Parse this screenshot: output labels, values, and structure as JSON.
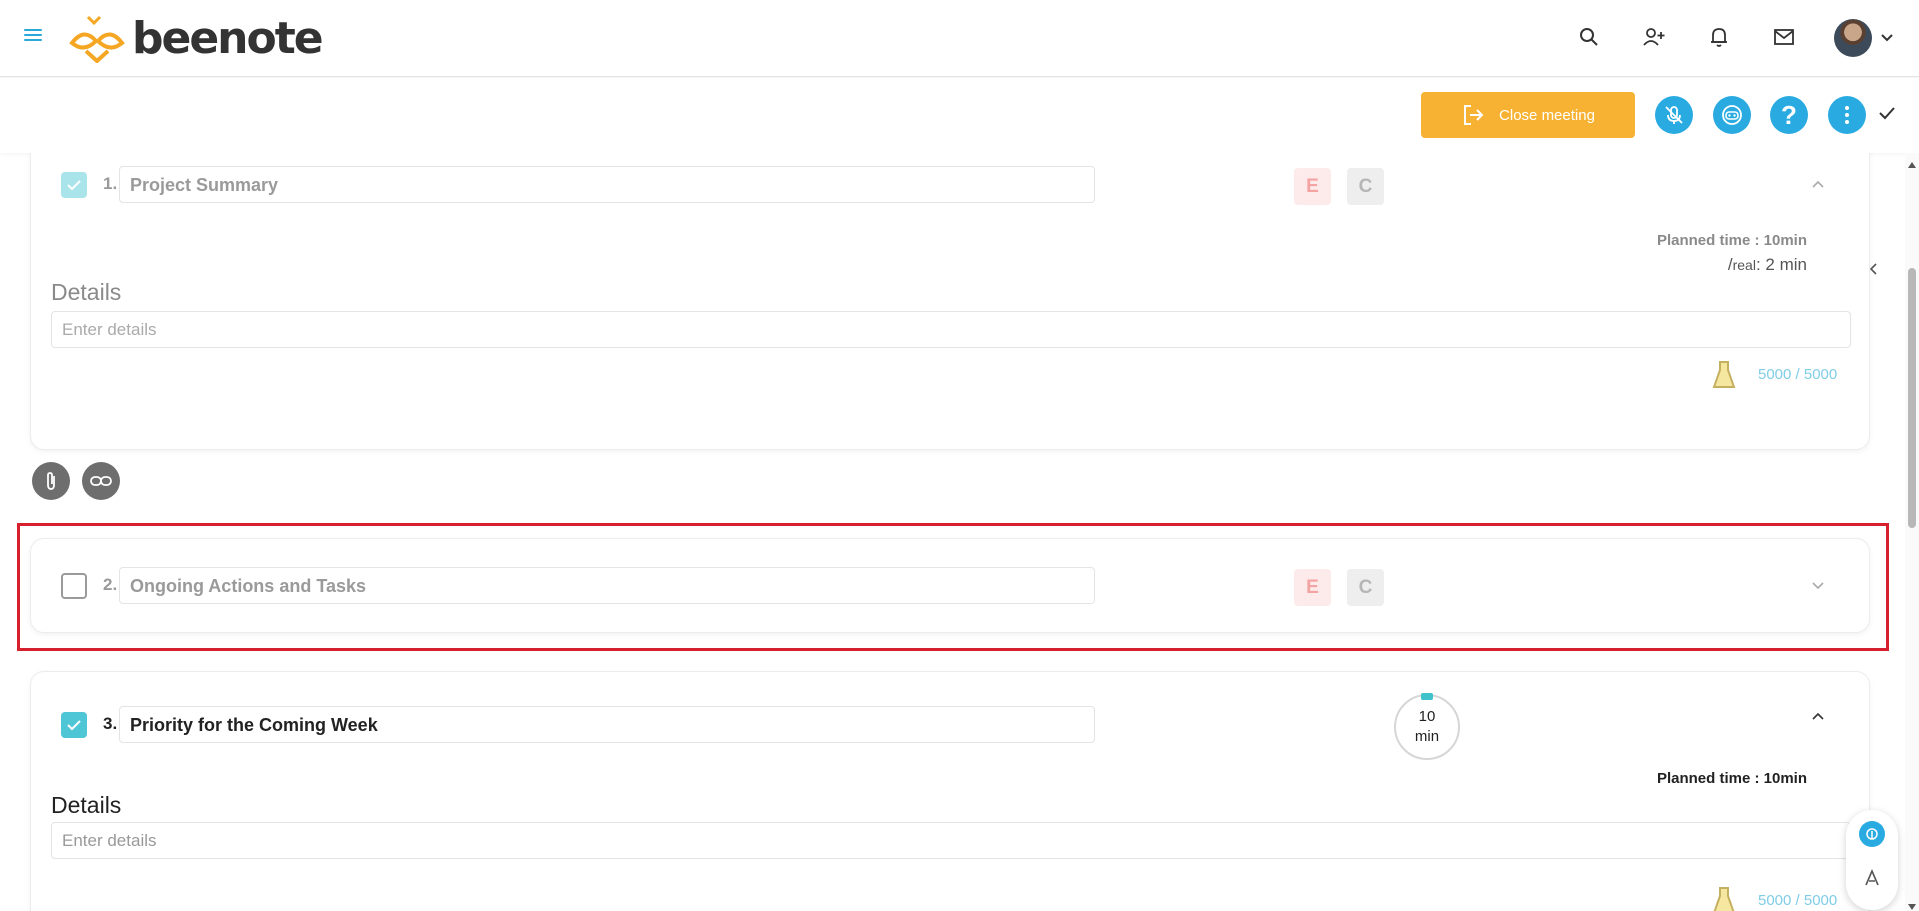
{
  "header": {
    "logo_text": "beenote"
  },
  "toolbar": {
    "close_meeting_label": "Close meeting"
  },
  "colors": {
    "brand_blue": "#29abe2",
    "close_button": "#f7b233",
    "check_teal": "#4fc6d6",
    "highlight_red": "#d6202d"
  },
  "items": [
    {
      "number": "1.",
      "title": "Project Summary",
      "checked": true,
      "badge_e": "E",
      "badge_c": "C",
      "planned_time": "Planned time : 10min",
      "real_prefix": "/",
      "real_label": "real",
      "real_value": ": 2 min",
      "details_label": "Details",
      "details_placeholder": "Enter details",
      "counter": "5000 / 5000"
    },
    {
      "number": "2.",
      "title": "Ongoing Actions and Tasks",
      "checked": false,
      "badge_e": "E",
      "badge_c": "C"
    },
    {
      "number": "3.",
      "title": "Priority for the Coming Week",
      "checked": true,
      "timer_value": "10",
      "timer_unit": "min",
      "planned_time": "Planned time : 10min",
      "details_label": "Details",
      "details_placeholder": "Enter details",
      "counter": "5000 / 5000"
    }
  ]
}
